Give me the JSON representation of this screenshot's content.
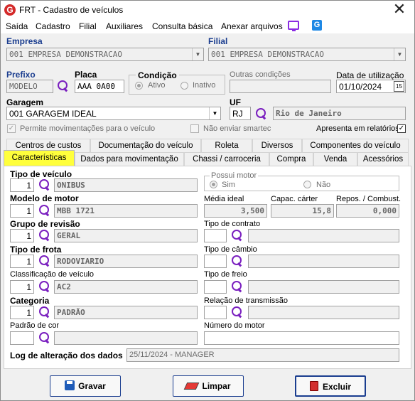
{
  "window": {
    "title": "FRT - Cadastro de veículos",
    "icon_letter": "G"
  },
  "menu": [
    "Saída",
    "Cadastro",
    "Filial",
    "Auxiliares",
    "Consulta básica",
    "Anexar arquivos"
  ],
  "header": {
    "empresa_label": "Empresa",
    "empresa_value": "001 EMPRESA DEMONSTRACAO",
    "filial_label": "Filial",
    "filial_value": "001 EMPRESA DEMONSTRACAO",
    "prefixo_label": "Prefixo",
    "prefixo_value": "MODELO",
    "placa_label": "Placa",
    "placa_value": "AAA 0A00",
    "condicao_label": "Condição",
    "ativo_label": "Ativo",
    "inativo_label": "Inativo",
    "outras_label": "Outras condições",
    "outras_value": "",
    "data_label": "Data de utilização",
    "data_value": "01/10/2024",
    "cal_label": "15",
    "garagem_label": "Garagem",
    "garagem_value": "001 GARAGEM IDEAL",
    "uf_label": "UF",
    "uf_value": "RJ",
    "uf_name": "Rio de Janeiro",
    "permite_label": "Permite movimentações para o veículo",
    "smartec_label": "Não enviar smartec",
    "relatorios_label": "Apresenta em relatórios",
    "check_mark": "✓"
  },
  "tabs_row1": [
    "Centros de custos",
    "Documentação do veículo",
    "Roleta",
    "Diversos",
    "Componentes do veículo"
  ],
  "tabs_row2": [
    "Características",
    "Dados para movimentação",
    "Chassi / carroceria",
    "Compra",
    "Venda",
    "Acessórios"
  ],
  "panel": {
    "tipo_veiculo_label": "Tipo de veículo",
    "tipo_veiculo_code": "1",
    "tipo_veiculo_value": "ONIBUS",
    "motor_group_label": "Possui motor",
    "sim_label": "Sim",
    "nao_label": "Não",
    "modelo_motor_label": "Modelo de motor",
    "modelo_motor_code": "1",
    "modelo_motor_value": "MBB 1721",
    "media_label": "Média ideal",
    "media_value": "3,500",
    "carter_label": "Capac. cárter",
    "carter_value": "15,8",
    "repos_label": "Repos. / Combust.",
    "repos_value": "0,000",
    "grupo_label": "Grupo de revisão",
    "grupo_code": "1",
    "grupo_value": "GERAL",
    "contrato_label": "Tipo de contrato",
    "contrato_code": "",
    "contrato_value": "",
    "frota_label": "Tipo de frota",
    "frota_code": "1",
    "frota_value": "RODOVIARIO",
    "cambio_label": "Tipo de câmbio",
    "cambio_code": "",
    "cambio_value": "",
    "classif_label": "Classificação de veículo",
    "classif_code": "1",
    "classif_value": "AC2",
    "freio_label": "Tipo de freio",
    "freio_code": "",
    "freio_value": "",
    "categoria_label": "Categoria",
    "categoria_code": "1",
    "categoria_value": "PADRÃO",
    "relacao_label": "Relação de transmissão",
    "relacao_code": "",
    "relacao_value": "",
    "padrao_cor_label": "Padrão de cor",
    "padrao_cor_code": "",
    "padrao_cor_value": "",
    "numero_motor_label": "Número do motor",
    "numero_motor_value": "",
    "log_label": "Log de alteração dos dados",
    "log_value": "25/11/2024 - MANAGER"
  },
  "buttons": {
    "gravar": "Gravar",
    "limpar": "Limpar",
    "excluir": "Excluir"
  }
}
